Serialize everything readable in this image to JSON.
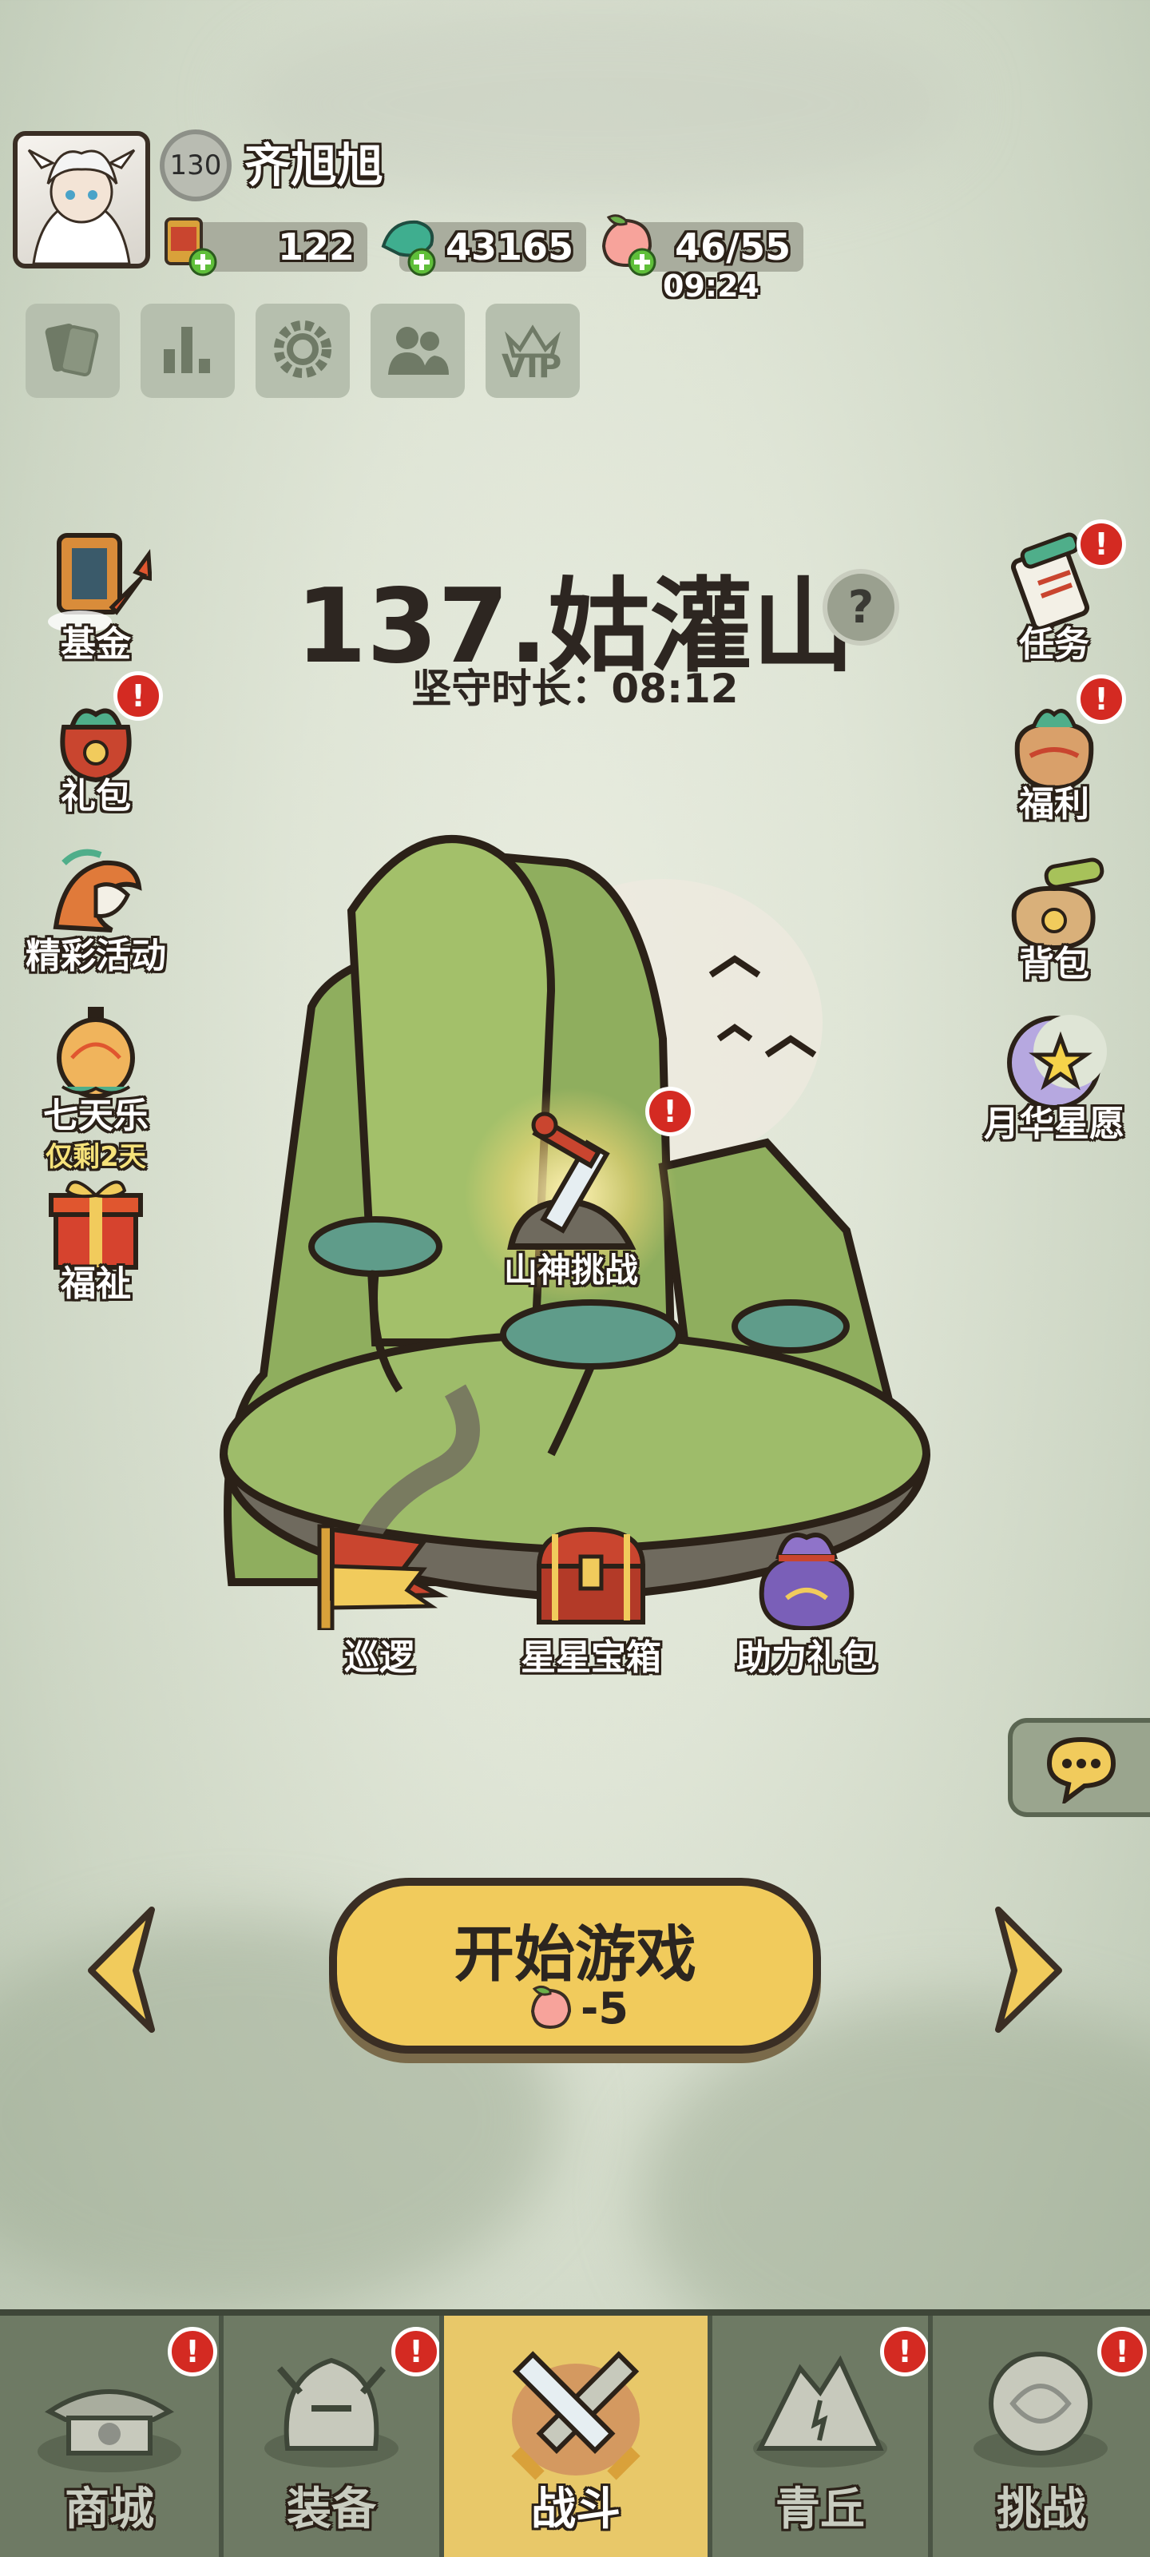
{
  "player": {
    "level": "130",
    "name": "齐旭旭"
  },
  "resources": {
    "scroll": "122",
    "jade": "43165",
    "stamina": "46/55",
    "stamina_timer": "09:24"
  },
  "toolbar": {
    "vip_label": "VIP"
  },
  "left_menu": [
    {
      "label": "基金"
    },
    {
      "label": "礼包"
    },
    {
      "label": "精彩活动"
    },
    {
      "label": "七天乐",
      "sub": "仅剩2天"
    },
    {
      "label": "福祉"
    }
  ],
  "right_menu": [
    {
      "label": "任务"
    },
    {
      "label": "福利"
    },
    {
      "label": "背包"
    },
    {
      "label": "月华星愿"
    }
  ],
  "stage": {
    "title": "137.姑灌山",
    "guard_time": "坚守时长：08:12",
    "challenge_label": "山神挑战",
    "help_icon": "?"
  },
  "stage_actions": [
    {
      "label": "巡逻"
    },
    {
      "label": "星星宝箱"
    },
    {
      "label": "助力礼包"
    }
  ],
  "start": {
    "label": "开始游戏",
    "cost": "-5"
  },
  "badge_text": "!",
  "nav": [
    {
      "label": "商城"
    },
    {
      "label": "装备"
    },
    {
      "label": "战斗"
    },
    {
      "label": "青丘"
    },
    {
      "label": "挑战"
    }
  ],
  "colors": {
    "accent": "#f1cb5c",
    "alert": "#d42a22",
    "nav_active": "#e8c869"
  }
}
